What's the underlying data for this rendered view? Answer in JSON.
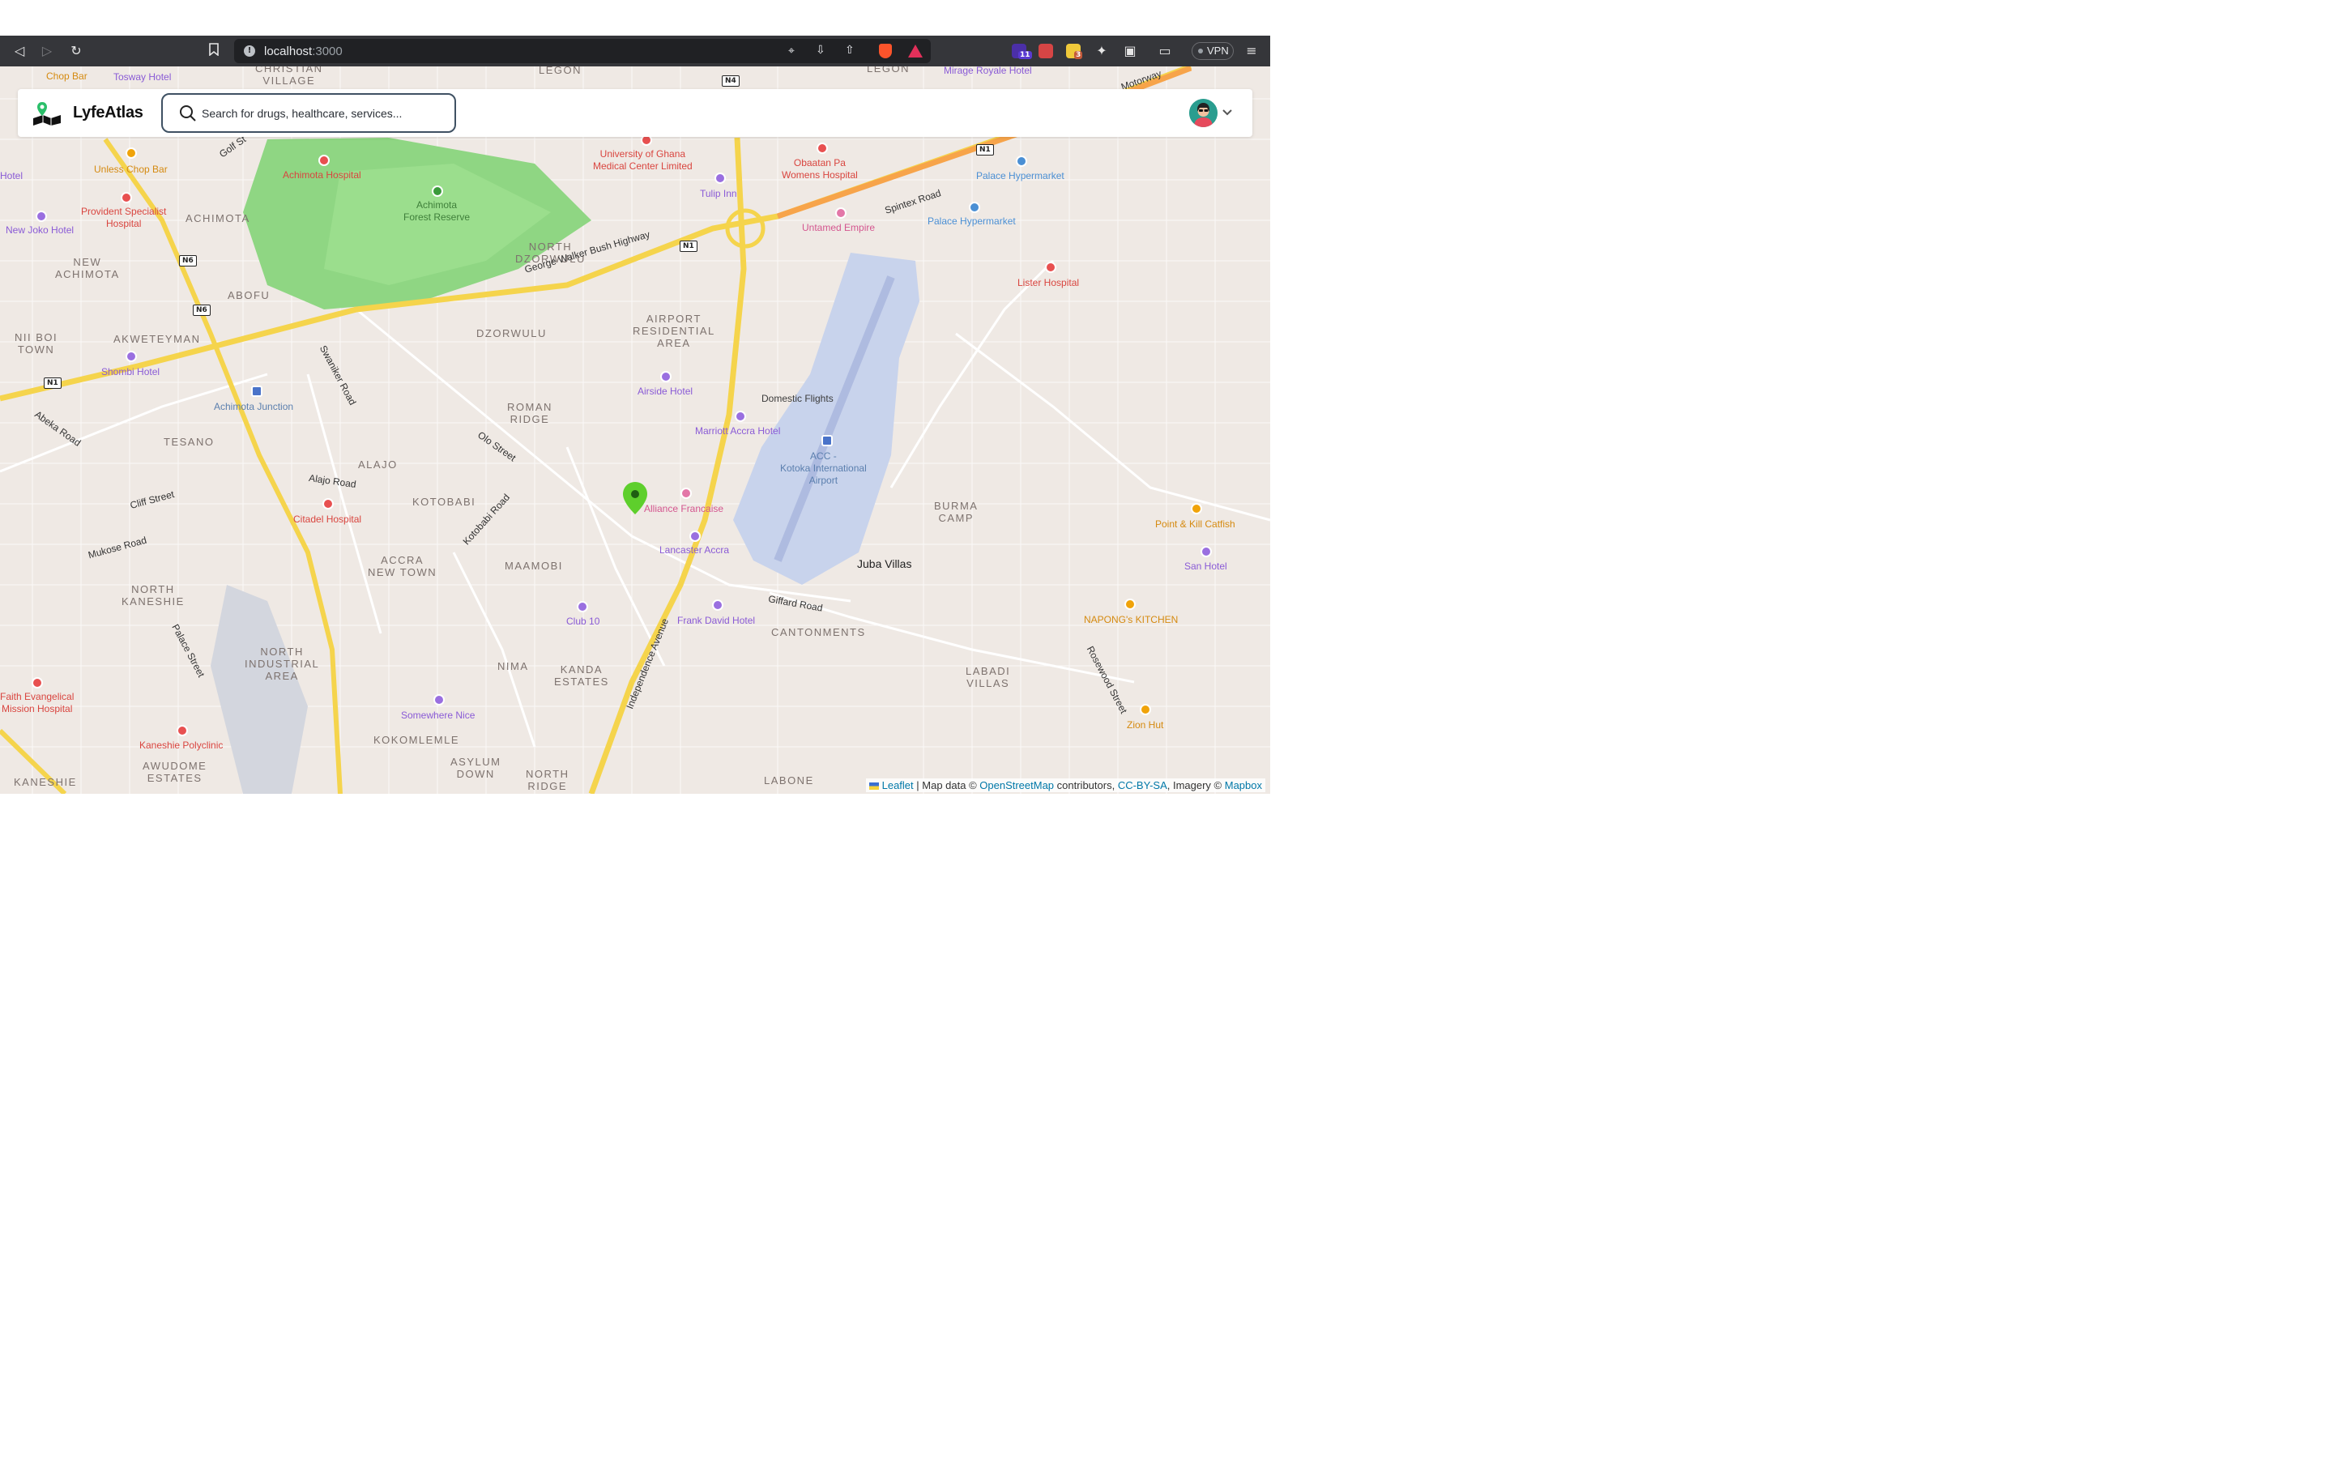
{
  "browser": {
    "url_host": "localhost",
    "url_port": ":3000",
    "vpn_label": "VPN",
    "ext_badges": [
      "11",
      "3"
    ],
    "colors": {
      "toolbar": "#35363a",
      "url_box": "#202124"
    }
  },
  "app": {
    "name": "LyfeAtlas",
    "search_placeholder": "Search for drugs, healthcare, services...",
    "accent": "#3f5163"
  },
  "map": {
    "labels": {
      "chop_bar": "Chop Bar",
      "tosway_hotel": "Tosway Hotel",
      "christian_village": "CHRISTIAN\nVILLAGE",
      "legon1": "LEGON",
      "legon2": "LEGON",
      "mirage": "Mirage Royale Hotel",
      "motorway": "Motorway",
      "hotel_left": "Hotel",
      "unless": "Unless Chop Bar",
      "golf": "Golf St",
      "achimota_hospital": "Achimota Hospital",
      "achimota_forest": "Achimota\nForest Reserve",
      "ug_medical": "University of Ghana\nMedical Center Limited",
      "obaatan": "Obaatan Pa\nWomens Hospital",
      "palace1": "Palace Hypermarket",
      "palace2": "Palace Hypermarket",
      "tulip": "Tulip Inn",
      "provident": "Provident Specialist\nHospital",
      "achimota": "ACHIMOTA",
      "new_joko": "New Joko Hotel",
      "untamed": "Untamed Empire",
      "spintex": "Spintex Road",
      "north_dzorwulu": "NORTH\nDZORWULU",
      "lister": "Lister Hospital",
      "new_achimota": "NEW\nACHIMOTA",
      "abofu": "ABOFU",
      "gwb_highway": "George Walker Bush Highway",
      "airport_res": "AIRPORT\nRESIDENTIAL\nAREA",
      "nii_boi": "NII BOI\nTOWN",
      "akweteyman": "AKWETEYMAN",
      "dzorwulu": "DZORWULU",
      "swaniker": "Swaniker Road",
      "shombi": "Shombi Hotel",
      "airside": "Airside Hotel",
      "domestic": "Domestic Flights",
      "achimota_junction": "Achimota Junction",
      "abeka": "Abeka Road",
      "roman_ridge": "ROMAN\nRIDGE",
      "marriott": "Marriott Accra Hotel",
      "tesano": "TESANO",
      "olo": "Olo Street",
      "acc": "ACC -\nKotoka International\nAirport",
      "alajo": "ALAJO",
      "alajo_road": "Alajo Road",
      "cliff": "Cliff Street",
      "kotobabi": "KOTOBABI",
      "kotobabi_road": "Kotobabi Road",
      "citadel": "Citadel Hospital",
      "alliance": "Alliance Francaise",
      "burma": "BURMA\nCAMP",
      "point_kill": "Point & Kill Catfish",
      "mukose": "Mukose Road",
      "lancaster": "Lancaster Accra",
      "accra_new_town": "ACCRA\nNEW TOWN",
      "maamobi": "MAAMOBI",
      "juba": "Juba Villas",
      "san_hotel": "San Hotel",
      "north_kaneshie": "NORTH\nKANESHIE",
      "giffard": "Giffard Road",
      "club10": "Club 10",
      "frank_david": "Frank David Hotel",
      "napong": "NAPONG's KITCHEN",
      "cantonments": "CANTONMENTS",
      "independence": "Independence Avenue",
      "palace_street": "Palace Street",
      "north_industrial": "NORTH\nINDUSTRIAL\nAREA",
      "nima": "NIMA",
      "kanda": "KANDA\nESTATES",
      "labadi": "LABADI\nVILLAS",
      "rosewood": "Rosewood Street",
      "faith": "Faith Evangelical\nMission Hospital",
      "somewhere": "Somewhere Nice",
      "zion": "Zion Hut",
      "kaneshie_poly": "Kaneshie Polyclinic",
      "kokomlemle": "KOKOMLEMLE",
      "awudome": "AWUDOME\nESTATES",
      "asylum": "ASYLUM\nDOWN",
      "north_ridge": "NORTH\nRIDGE",
      "labone": "LABONE",
      "kaneshie": "KANESHIE"
    },
    "shields": {
      "n4": "N4",
      "n1a": "N1",
      "n6a": "N6",
      "n6b": "N6",
      "n1b": "N1",
      "n1c": "N1"
    },
    "attribution": {
      "leaflet": "Leaflet",
      "sep": " | Map data © ",
      "osm": "OpenStreetMap",
      "contrib": " contributors, ",
      "ccbysa": "CC-BY-SA",
      "imagery": ", Imagery © ",
      "mapbox": "Mapbox"
    },
    "colors": {
      "land": "#efe9e4",
      "park": "#8fd683",
      "water": "#c8d3ec",
      "highway": "#f5d44c",
      "motorway": "#f7a44a",
      "marker": "#5ecf2c"
    }
  }
}
